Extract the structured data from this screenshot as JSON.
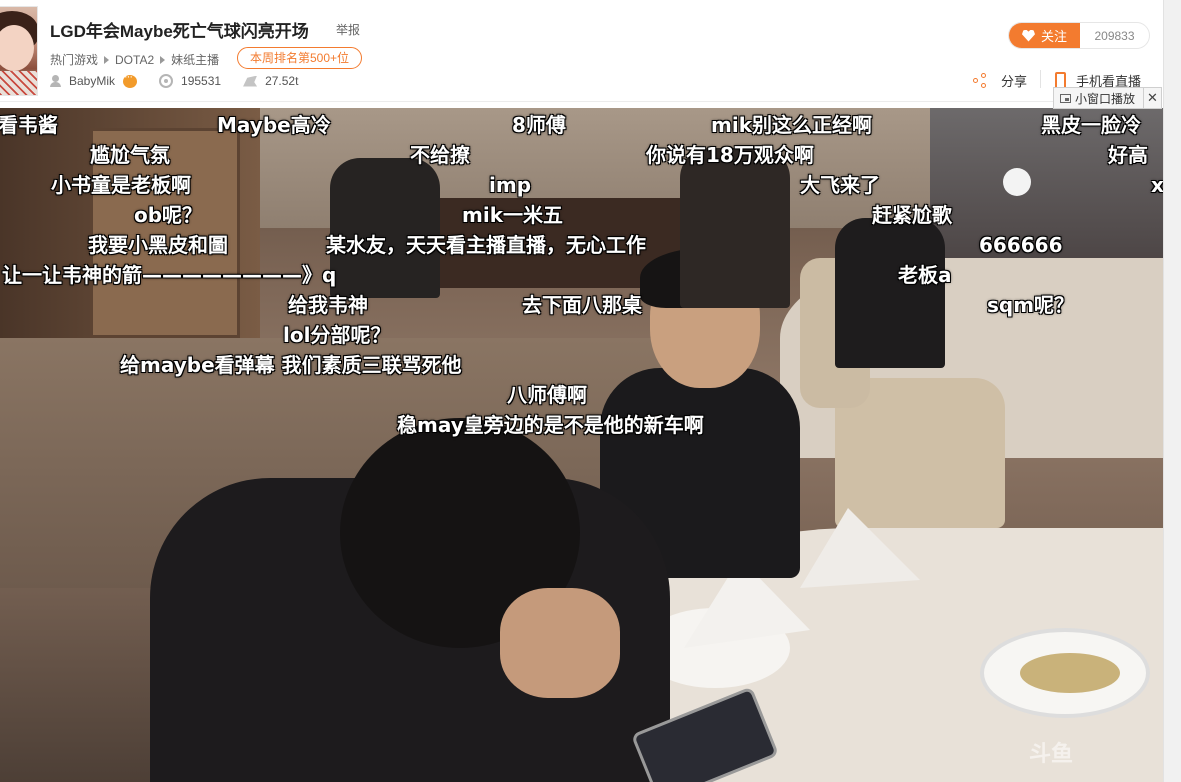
{
  "header": {
    "title": "LGD年会Maybe死亡气球闪亮开场",
    "report_label": "举报",
    "breadcrumbs": [
      "热门游戏",
      "DOTA2",
      "妹纸主播"
    ],
    "rank_badge": "本周排名第500+位",
    "streamer_name": "BabyMik",
    "viewers": "195531",
    "weight": "27.52t",
    "follow_label": "关注",
    "follow_count": "209833",
    "share_label": "分享",
    "mobile_label": "手机看直播",
    "mini_window_label": "小窗口播放",
    "mini_window_close": "✕"
  },
  "video": {
    "watermark": "斗鱼",
    "danmaku": [
      "看韦酱",
      "Maybe高冷",
      "8师傅",
      "mik别这么正经啊",
      "黑皮一脸冷",
      "尴尬气氛",
      "不给撩",
      "你说有18万观众啊",
      "好高",
      "小书童是老板啊",
      "imp",
      "大飞来了",
      "x",
      "ob呢？",
      "mik一米五",
      "赶紧尬歌",
      "我要小黑皮和圖",
      "某水友，天天看主播直播，无心工作",
      "666666",
      "让一让韦神的箭————————》q",
      "老板a",
      "给我韦神",
      "去下面八那桌",
      "sqm呢？",
      "lol分部呢？",
      "给maybe看弹幕 我们素质三联骂死他",
      "八师傅啊",
      "稳may皇旁边的是不是他的新车啊"
    ]
  },
  "colors": {
    "accent": "#f37b2f",
    "danmaku_text": "#ffffff"
  }
}
